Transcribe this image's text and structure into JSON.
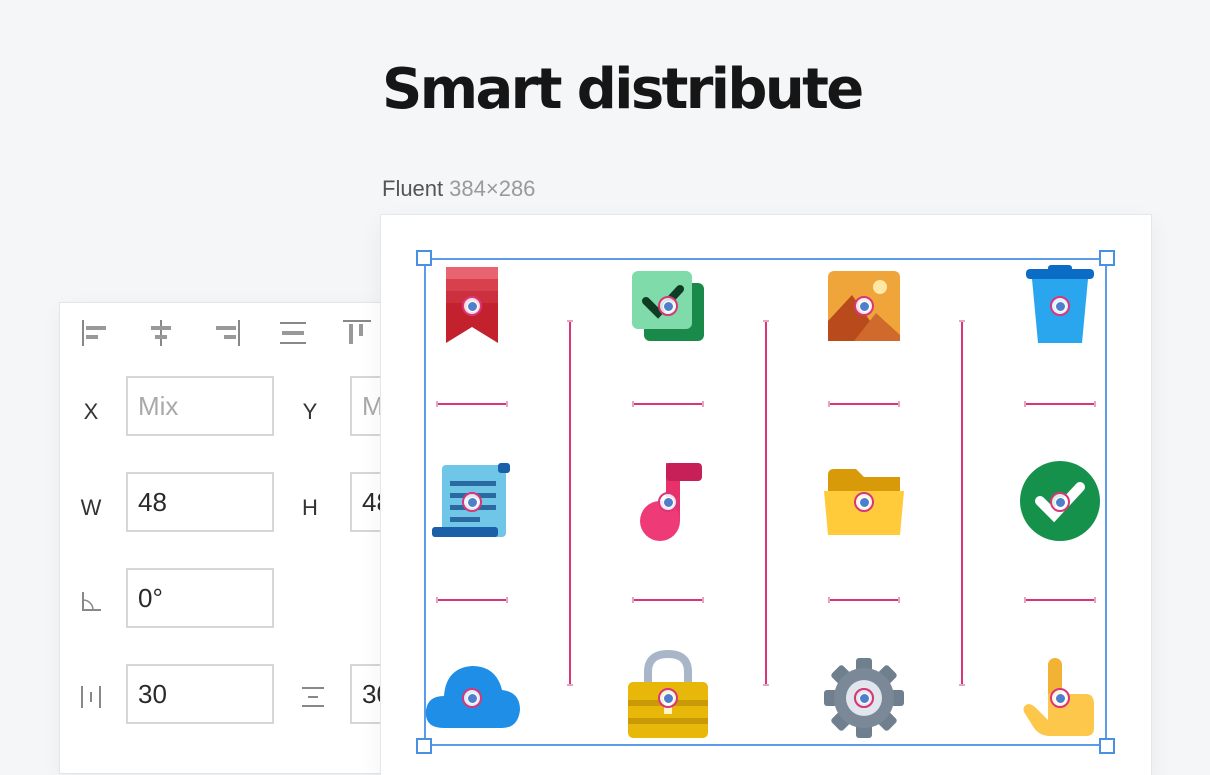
{
  "page": {
    "title": "Smart distribute"
  },
  "frame": {
    "name": "Fluent",
    "size": "384×286"
  },
  "inspector": {
    "x_label": "X",
    "x_value": "Mix",
    "y_label": "Y",
    "y_value": "M",
    "w_label": "W",
    "w_value": "48",
    "h_label": "H",
    "h_value": "48",
    "rotation_value": "0°",
    "h_spacing_value": "30",
    "v_spacing_value": "30",
    "align_tools": [
      "align-left-icon",
      "align-center-icon",
      "align-right-icon",
      "align-middle-icon",
      "align-top-icon"
    ]
  },
  "icons": [
    "bookmark-icon",
    "to-do-icon",
    "photos-icon",
    "recycle-bin-icon",
    "document-icon",
    "music-icon",
    "folder-icon",
    "checkmark-icon",
    "cloud-icon",
    "lock-icon",
    "settings-icon",
    "touch-icon"
  ],
  "colors": {
    "selection": "#5b9be8",
    "guide": "#d9367a",
    "background": "#f5f6f8"
  }
}
